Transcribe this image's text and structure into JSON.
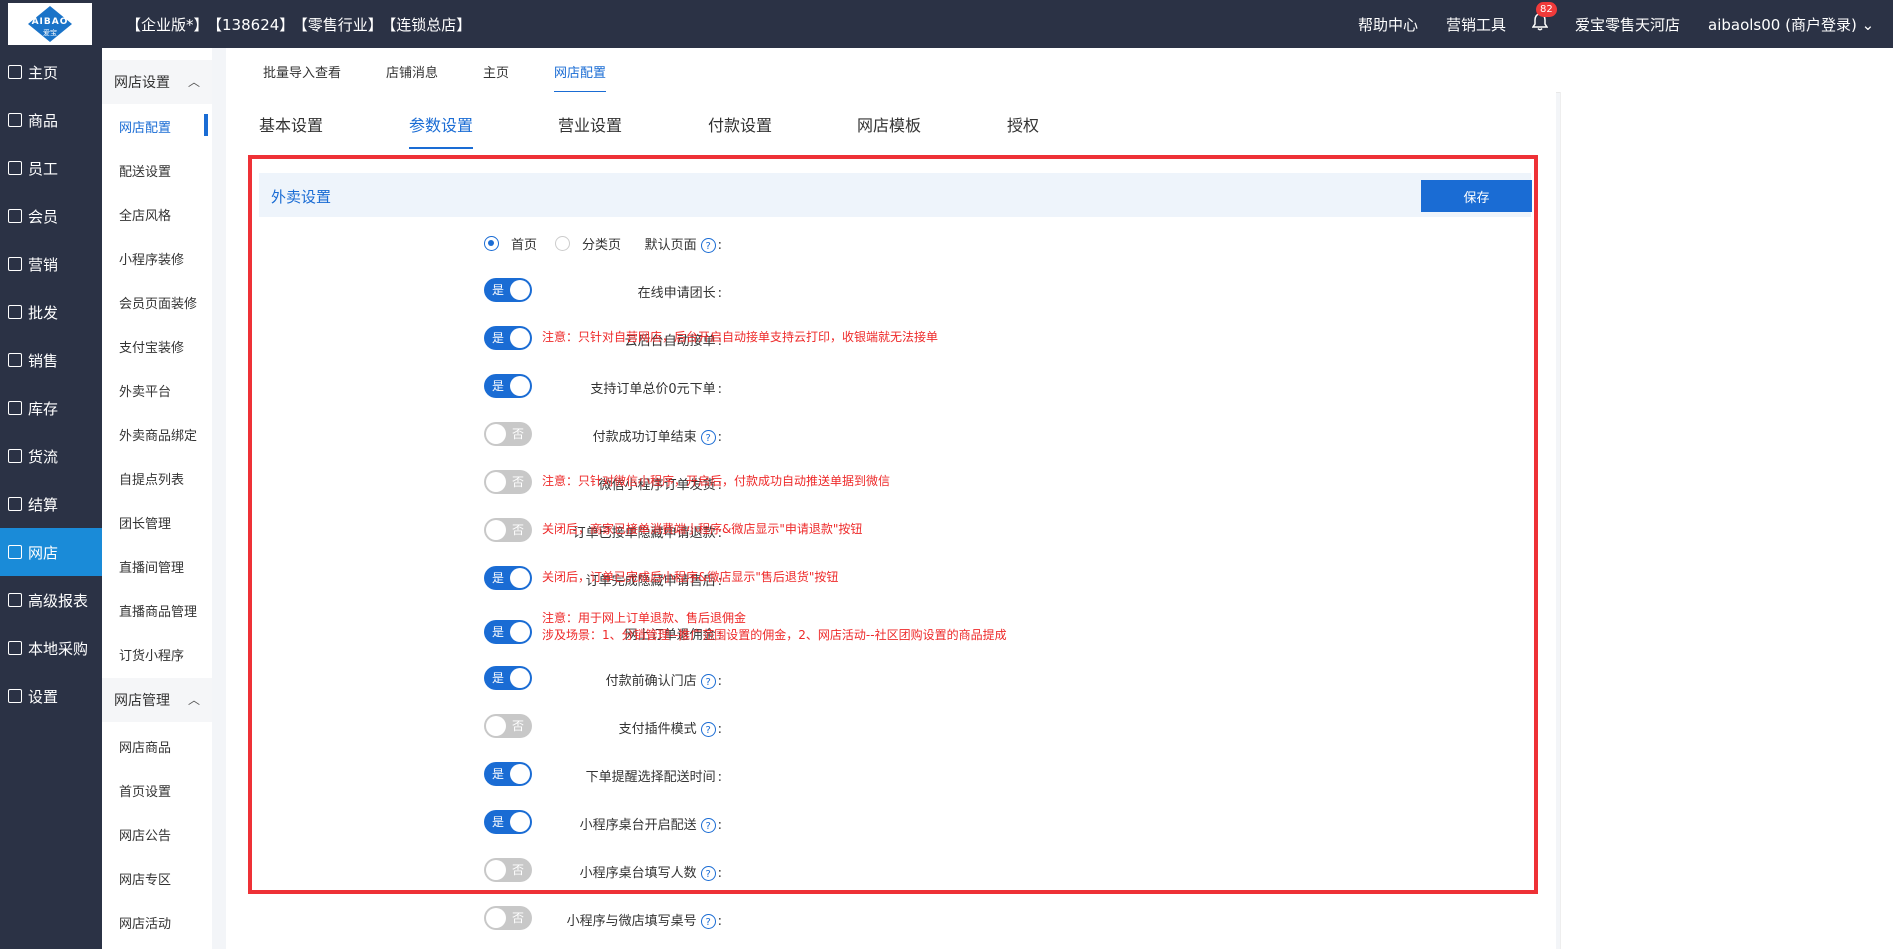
{
  "header": {
    "logo_text": "AIBAO",
    "logo_sub": "爱宝",
    "edition": "【企业版*】",
    "account_id": "【138624】",
    "industry": "【零售行业】",
    "store_type": "【连锁总店】",
    "help": "帮助中心",
    "marketing_tools": "营销工具",
    "notifications": "82",
    "store_name": "爱宝零售天河店",
    "user": "aibaols00 (商户登录)"
  },
  "sidebar": {
    "items": [
      {
        "label": "主页",
        "icon": "home-icon"
      },
      {
        "label": "商品",
        "icon": "goods-icon"
      },
      {
        "label": "员工",
        "icon": "staff-icon"
      },
      {
        "label": "会员",
        "icon": "member-icon"
      },
      {
        "label": "营销",
        "icon": "megaphone-icon"
      },
      {
        "label": "批发",
        "icon": "wholesale-icon"
      },
      {
        "label": "销售",
        "icon": "bar-chart-icon"
      },
      {
        "label": "库存",
        "icon": "inventory-icon"
      },
      {
        "label": "货流",
        "icon": "cube-icon"
      },
      {
        "label": "结算",
        "icon": "settle-icon"
      },
      {
        "label": "网店",
        "icon": "gift-icon"
      },
      {
        "label": "高级报表",
        "icon": "line-chart-icon"
      },
      {
        "label": "本地采购",
        "icon": "purchase-icon"
      },
      {
        "label": "设置",
        "icon": "gear-icon"
      }
    ],
    "active": "网店"
  },
  "subnav": {
    "group1": "网店设置",
    "group1_items": [
      "网店配置",
      "配送设置",
      "全店风格",
      "小程序装修",
      "会员页面装修",
      "支付宝装修",
      "外卖平台",
      "外卖商品绑定",
      "自提点列表",
      "团长管理",
      "直播间管理",
      "直播商品管理",
      "订货小程序"
    ],
    "group2": "网店管理",
    "group2_items": [
      "网店商品",
      "首页设置",
      "网店公告",
      "网店专区",
      "网店活动"
    ],
    "active": "网店配置"
  },
  "page_tabs": [
    "批量导入查看",
    "店铺消息",
    "主页",
    "网店配置"
  ],
  "page_tab_active": "网店配置",
  "settings_tabs": [
    "基本设置",
    "参数设置",
    "营业设置",
    "付款设置",
    "网店模板",
    "授权"
  ],
  "settings_tab_active": "参数设置",
  "section": {
    "title": "外卖设置",
    "save_label": "保存"
  },
  "default_page": {
    "label": "默认页面",
    "options": [
      "首页",
      "分类页"
    ],
    "selected": "首页"
  },
  "toggles": [
    {
      "label": "在线申请团长",
      "help": false,
      "on": true,
      "note": ""
    },
    {
      "label": "云后台自动接单",
      "help": false,
      "on": true,
      "note": "注意：只针对自营网店，后台开启自动接单支持云打印，收银端就无法接单"
    },
    {
      "label": "支持订单总价0元下单",
      "help": false,
      "on": true,
      "note": ""
    },
    {
      "label": "付款成功订单结束",
      "help": true,
      "on": false,
      "note": ""
    },
    {
      "label": "微信小程序订单发货",
      "help": false,
      "on": false,
      "note": "注意：只针对微信小程序，开启后，付款成功自动推送单据到微信"
    },
    {
      "label": "订单已接单隐藏申请退款",
      "help": false,
      "on": false,
      "note": "关闭后，商家已接单消费端小程序&微店显示\"申请退款\"按钮"
    },
    {
      "label": "订单完成隐藏申请售后",
      "help": false,
      "on": true,
      "note": "关闭后，订单已完成后小程序&微店显示\"售后退货\"按钮"
    },
    {
      "label": "网上订单退佣金",
      "help": false,
      "on": true,
      "note": "注意：用于网上订单退款、售后退佣金",
      "note2": "涉及场景：1、分销管理--推广范围设置的佣金，2、网店活动--社区团购设置的商品提成"
    },
    {
      "label": "付款前确认门店",
      "help": true,
      "on": true,
      "note": ""
    },
    {
      "label": "支付插件模式",
      "help": true,
      "on": false,
      "note": ""
    },
    {
      "label": "下单提醒选择配送时间",
      "help": false,
      "on": true,
      "note": ""
    },
    {
      "label": "小程序桌台开启配送",
      "help": true,
      "on": true,
      "note": ""
    },
    {
      "label": "小程序桌台填写人数",
      "help": true,
      "on": false,
      "note": ""
    },
    {
      "label": "小程序与微店填写桌号",
      "help": true,
      "on": false,
      "note": ""
    }
  ],
  "toggle_text": {
    "on": "是",
    "off": "否"
  },
  "colors": {
    "accent": "#1a6cd4",
    "sidebar": "#2b3245",
    "highlight_border": "#ee3136",
    "note": "#ee2a2a"
  }
}
